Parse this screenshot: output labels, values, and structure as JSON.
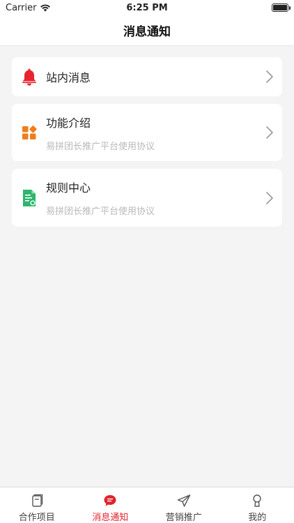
{
  "status_bar": {
    "carrier": "Carrier",
    "time": "6:25 PM"
  },
  "nav": {
    "title": "消息通知"
  },
  "cards": [
    {
      "title": "站内消息",
      "subtitle": "",
      "icon": "bell-icon",
      "icon_color": "#e8232f"
    },
    {
      "title": "功能介绍",
      "subtitle": "易拼团长推广平台使用协议",
      "icon": "grid-icon",
      "icon_color": "#f07d1c"
    },
    {
      "title": "规则中心",
      "subtitle": "易拼团长推广平台使用协议",
      "icon": "document-icon",
      "icon_color": "#2db56e"
    }
  ],
  "tabs": [
    {
      "label": "合作项目",
      "icon": "book-icon",
      "active": false
    },
    {
      "label": "消息通知",
      "icon": "chat-bubble-icon",
      "active": true
    },
    {
      "label": "营销推广",
      "icon": "paper-plane-icon",
      "active": false
    },
    {
      "label": "我的",
      "icon": "person-icon",
      "active": false
    }
  ],
  "colors": {
    "accent": "#e0232c",
    "background": "#f4f4f4",
    "subtitle": "#b9b9b9"
  }
}
